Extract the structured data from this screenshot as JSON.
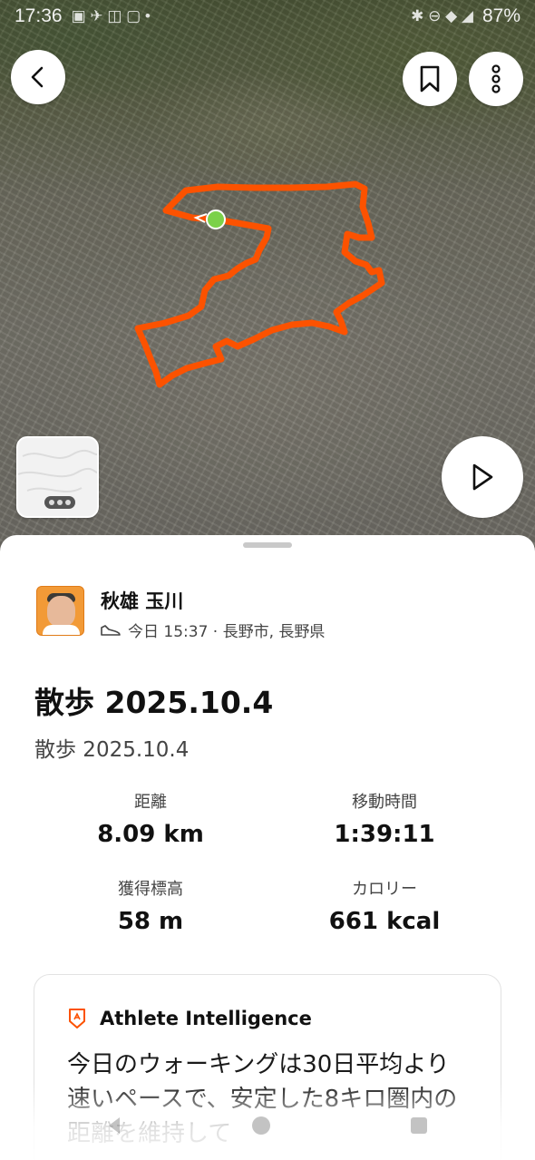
{
  "status_bar": {
    "time": "17:36",
    "battery": "87%"
  },
  "map": {
    "route_color": "#fc5200",
    "start_marker_color": "#7bd14a"
  },
  "athlete": {
    "name": "秋雄 玉川",
    "meta": "今日 15:37 · 長野市, 長野県"
  },
  "activity": {
    "title": "散歩 2025.10.4",
    "description": "散歩 2025.10.4"
  },
  "stats": [
    {
      "label": "距離",
      "value": "8.09 km"
    },
    {
      "label": "移動時間",
      "value": "1:39:11"
    },
    {
      "label": "獲得標高",
      "value": "58 m"
    },
    {
      "label": "カロリー",
      "value": "661 kcal"
    }
  ],
  "athlete_intelligence": {
    "title": "Athlete Intelligence",
    "body": "今日のウォーキングは30日平均より速いペースで、安定した8キロ圏内の距離を維持して"
  },
  "icons": {
    "back": "chevron-left-icon",
    "bookmark": "bookmark-icon",
    "more": "more-vertical-icon",
    "play": "play-icon",
    "shoe": "shoe-icon",
    "ai": "athlete-intelligence-icon"
  },
  "colors": {
    "accent": "#fc5200",
    "text_primary": "#111111",
    "text_secondary": "#444444"
  }
}
